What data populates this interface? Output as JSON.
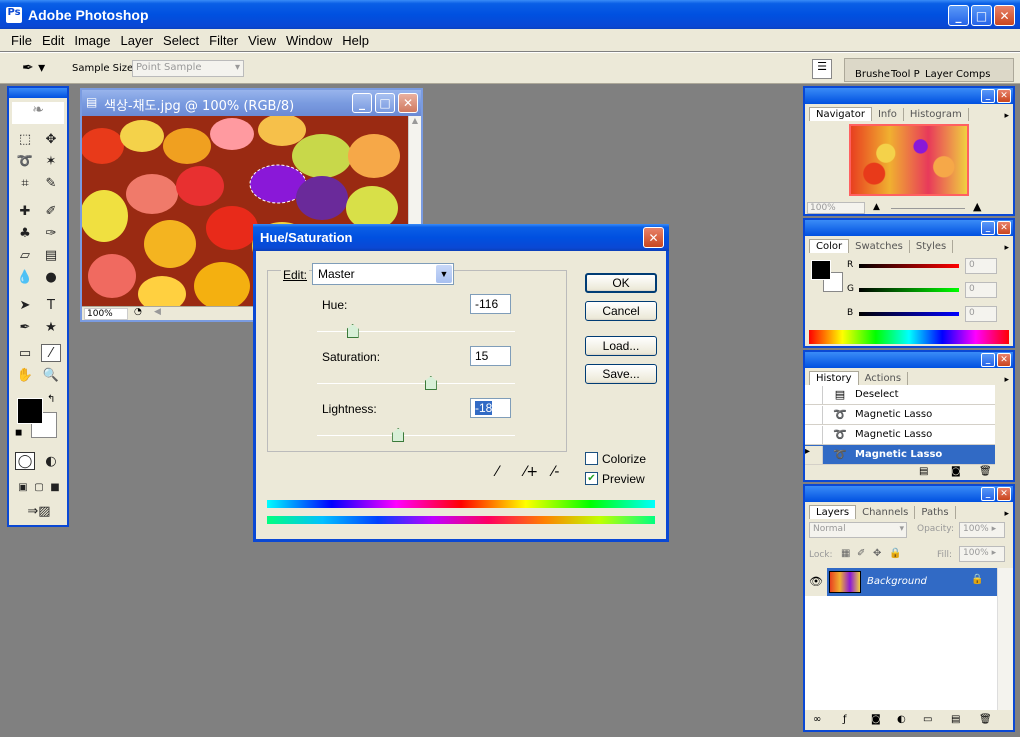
{
  "app": {
    "title": "Adobe Photoshop"
  },
  "menu": [
    "File",
    "Edit",
    "Image",
    "Layer",
    "Select",
    "Filter",
    "View",
    "Window",
    "Help"
  ],
  "options": {
    "sample_size_label": "Sample Size:",
    "sample_size_value": "Point Sample",
    "well_tabs": [
      "Brushe",
      "Tool P",
      "Layer Comps"
    ]
  },
  "document": {
    "title": "색상-채도.jpg @ 100% (RGB/8)",
    "zoom": "100%"
  },
  "hue_sat": {
    "title": "Hue/Saturation",
    "edit_label": "Edit:",
    "edit_value": "Master",
    "hue_label": "Hue:",
    "hue_value": "-116",
    "hue_pos": 0.18,
    "sat_label": "Saturation:",
    "sat_value": "15",
    "sat_pos": 0.575,
    "light_label": "Lightness:",
    "light_value": "-18",
    "light_pos": 0.41,
    "ok": "OK",
    "cancel": "Cancel",
    "load": "Load...",
    "save": "Save...",
    "colorize": "Colorize",
    "preview": "Preview",
    "colorize_checked": false,
    "preview_checked": true
  },
  "navigator": {
    "tabs": [
      "Navigator",
      "Info",
      "Histogram"
    ],
    "zoom": "100%"
  },
  "color": {
    "tabs": [
      "Color",
      "Swatches",
      "Styles"
    ],
    "r": "R",
    "g": "G",
    "b": "B",
    "r_val": "0",
    "g_val": "0",
    "b_val": "0"
  },
  "history": {
    "tabs": [
      "History",
      "Actions"
    ],
    "items": [
      "Deselect",
      "Magnetic Lasso",
      "Magnetic Lasso",
      "Magnetic Lasso"
    ]
  },
  "layers": {
    "tabs": [
      "Layers",
      "Channels",
      "Paths"
    ],
    "blend": "Normal",
    "opacity_label": "Opacity:",
    "opacity": "100%",
    "lock_label": "Lock:",
    "fill_label": "Fill:",
    "fill": "100%",
    "layer_name": "Background"
  },
  "colors": {
    "accent": "#0a48d4",
    "selected": "#316ac5"
  }
}
